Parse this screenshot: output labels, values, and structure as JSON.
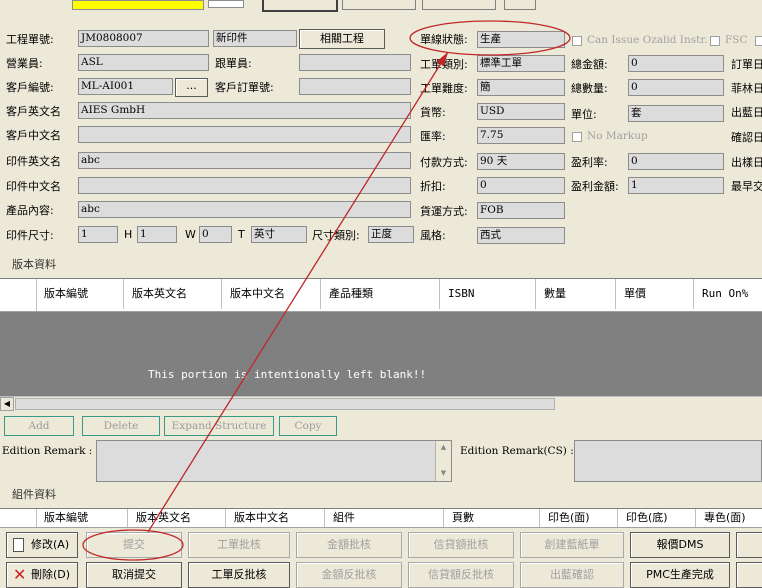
{
  "header": {
    "job_no_label": "工程單號:",
    "job_no": "JM0808007",
    "print_type": "新印件",
    "related_btn": "相關工程",
    "status_label": "單線狀態:",
    "status": "生產",
    "can_issue_label": "Can Issue Ozalid Instr.",
    "fsc_label": "FSC"
  },
  "left": {
    "sales_label": "營業員:",
    "sales": "ASL",
    "follow_label": "跟單員:",
    "cust_no_label": "客戶編號:",
    "cust_no": "ML-AI001",
    "cust_po_label": "客戶訂單號:",
    "cust_en_label": "客戶英文名",
    "cust_en": "AIES GmbH",
    "cust_cn_label": "客戶中文名",
    "print_en_label": "印件英文名",
    "print_en": "abc",
    "print_cn_label": "印件中文名",
    "content_label": "產品內容:",
    "content": "abc",
    "size_label": "印件尺寸:",
    "size_l": "1",
    "h_label": "H",
    "size_h": "1",
    "w_label": "W",
    "size_w": "0",
    "t_label": "T",
    "unit": "英寸",
    "size_cat_label": "尺寸類別:",
    "size_cat": "正度"
  },
  "middle": {
    "job_cat_label": "工單類別:",
    "job_cat": "標準工單",
    "difficulty_label": "工單難度:",
    "difficulty": "簡",
    "currency_label": "貨幣:",
    "currency": "USD",
    "rate_label": "匯率:",
    "rate": "7.75",
    "pay_label": "付款方式:",
    "pay": "90 天",
    "discount_label": "折扣:",
    "discount": "0",
    "ship_label": "貨運方式:",
    "ship": "FOB",
    "style_label": "風格:",
    "style": "西式"
  },
  "right": {
    "total_amt_label": "總金額:",
    "total_amt": "0",
    "total_qty_label": "總數量:",
    "total_qty": "0",
    "unit_label": "單位:",
    "unit": "套",
    "no_markup_label": "No Markup",
    "margin_label": "盈利率:",
    "margin": "0",
    "profit_label": "盈利金額:",
    "profit": "1",
    "cut1": "訂單日",
    "cut2": "菲林日",
    "cut3": "出藍日",
    "cut4": "確認日",
    "cut5": "出樣日",
    "cut6": "最早交"
  },
  "edition": {
    "section_label": "版本資料",
    "columns": [
      "版本編號",
      "版本英文名",
      "版本中文名",
      "產品種類",
      "ISBN",
      "數量",
      "單價",
      "Run On%"
    ],
    "blank_msg": "This portion is intentionally left blank!!",
    "add": "Add",
    "delete": "Delete",
    "expand": "Expand Structure",
    "copy": "Copy",
    "remark_label": "Edition Remark :",
    "remark_cs_label": "Edition Remark(CS) :"
  },
  "components": {
    "section_label": "組件資料",
    "columns": [
      "版本編號",
      "版本英文名",
      "版本中文名",
      "組件",
      "頁數",
      "印色(面)",
      "印色(底)",
      "專色(面)"
    ]
  },
  "actions": {
    "row1": [
      "修改(A)",
      "提交",
      "工單批核",
      "金額批核",
      "信貸額批核",
      "創建藍紙單",
      "報價DMS"
    ],
    "row2": [
      "刪除(D)",
      "取消提交",
      "工單反批核",
      "金額反批核",
      "信貸額反批核",
      "出藍確認",
      "PMC生產完成"
    ]
  },
  "colors": {
    "annotation": "#c0282a",
    "yellow": "#ffff00",
    "blank_area": "#808080"
  }
}
